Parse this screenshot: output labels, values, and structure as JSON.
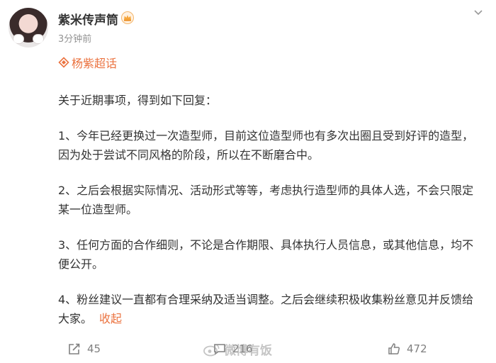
{
  "post": {
    "author": "紫米传声筒",
    "time": "3分钟前",
    "topic": "杨紫超话",
    "paragraphs": [
      "关于近期事项，得到如下回复：",
      "1、今年已经更换过一次造型师，目前这位造型师也有多次出圈且受到好评的造型，因为处于尝试不同风格的阶段，所以在不断磨合中。",
      "2、之后会根据实际情况、活动形式等等，考虑执行造型师的具体人选，不会只限定某一位造型师。",
      "3、任何方面的合作细则，不论是合作期限、具体执行人员信息，或其他信息，均不便公开。"
    ],
    "last_paragraph": "4、粉丝建议一直都有合理采纳及适当调整。之后会继续积极收集粉丝意见并反馈给大家。",
    "collapse_label": "收起"
  },
  "actions": {
    "share_count": "45",
    "comment_count": "216",
    "like_count": "472"
  },
  "watermark": "微博有饭",
  "colors": {
    "accent": "#eb7340",
    "text": "#333333",
    "muted": "#939393"
  },
  "icons": [
    "avatar",
    "crown-icon",
    "chevron-down-icon",
    "super-topic-icon",
    "share-icon",
    "comment-icon",
    "like-icon"
  ]
}
